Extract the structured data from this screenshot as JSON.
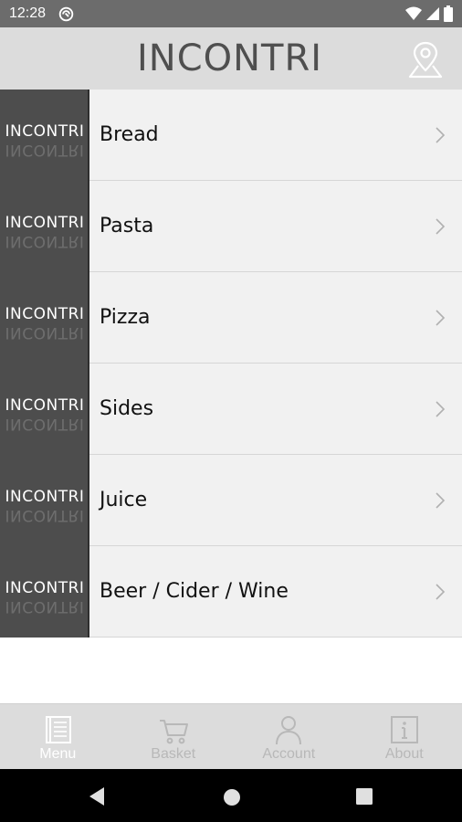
{
  "status_bar": {
    "time": "12:28"
  },
  "header": {
    "logo_text": "INCONTRI"
  },
  "menu": {
    "thumb_logo": "INCONTRI",
    "items": [
      {
        "label": "Bread"
      },
      {
        "label": "Pasta"
      },
      {
        "label": "Pizza"
      },
      {
        "label": "Sides"
      },
      {
        "label": "Juice"
      },
      {
        "label": "Beer / Cider / Wine"
      }
    ]
  },
  "tabs": [
    {
      "label": "Menu",
      "icon": "menu-book-icon",
      "active": true
    },
    {
      "label": "Basket",
      "icon": "cart-icon",
      "active": false
    },
    {
      "label": "Account",
      "icon": "person-icon",
      "active": false
    },
    {
      "label": "About",
      "icon": "info-icon",
      "active": false
    }
  ],
  "colors": {
    "status_bar": "#6c6c6c",
    "header_bg": "#dcdcdc",
    "thumb_bg": "#4d4d4d",
    "row_bg": "#f1f1f1",
    "tab_inactive": "#b8b8b8",
    "tab_active": "#ffffff"
  }
}
